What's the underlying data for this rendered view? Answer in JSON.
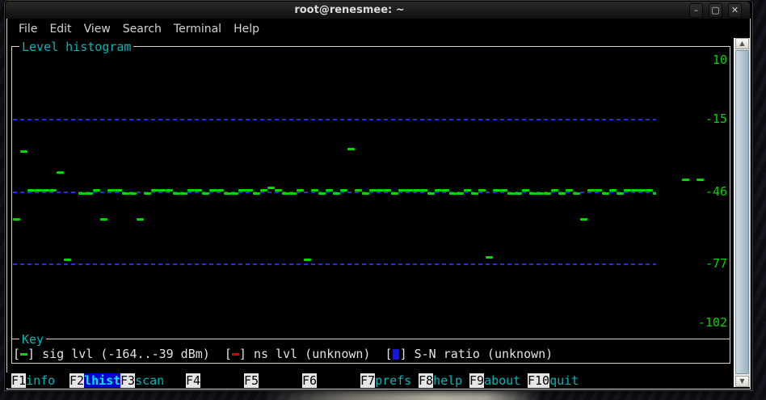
{
  "window": {
    "title": "root@renesmee: ~",
    "controls": [
      {
        "name": "minimize",
        "glyph": "–"
      },
      {
        "name": "maximize",
        "glyph": "▢"
      },
      {
        "name": "close",
        "glyph": "✕"
      }
    ]
  },
  "menu_items": [
    "File",
    "Edit",
    "View",
    "Search",
    "Terminal",
    "Help"
  ],
  "histogram_panel": {
    "title": "Level histogram"
  },
  "key_panel": {
    "title": "Key",
    "entries": [
      {
        "symbol": "dash",
        "symbol_color": "#00d800",
        "label": "sig lvl (-164..-39 dBm)"
      },
      {
        "symbol": "dash",
        "symbol_color": "#d40000",
        "label": "ns lvl (unknown)"
      },
      {
        "symbol": "block",
        "symbol_color": "#1616d6",
        "label": "S-N ratio (unknown)"
      }
    ]
  },
  "fkeys": [
    {
      "key": "F1",
      "label": "info",
      "active": false
    },
    {
      "key": "F2",
      "label": "lhist",
      "active": true
    },
    {
      "key": "F3",
      "label": "scan",
      "active": false
    },
    {
      "key": "F4",
      "label": "",
      "active": false
    },
    {
      "key": "F5",
      "label": "",
      "active": false
    },
    {
      "key": "F6",
      "label": "",
      "active": false
    },
    {
      "key": "F7",
      "label": "prefs",
      "active": false
    },
    {
      "key": "F8",
      "label": "help",
      "active": false
    },
    {
      "key": "F9",
      "label": "about",
      "active": false
    },
    {
      "key": "F10",
      "label": "quit",
      "active": false
    }
  ],
  "chart_data": {
    "type": "line",
    "title": "Level histogram",
    "ylabel": "",
    "ylim": [
      -102,
      10
    ],
    "yticks": [
      10,
      -15,
      -46,
      -77,
      -102
    ],
    "dashed_gridlines_at": [
      -15,
      -46,
      -77
    ],
    "legend_position": "bottom",
    "series": [
      {
        "name": "sig lvl (dBm)",
        "color": "#00d900",
        "samples_dbm": [
          -58,
          -29,
          -45.5,
          -45.5,
          -45.5,
          -45.5,
          -38,
          -75,
          null,
          -46.8,
          -46.8,
          -45.5,
          -58,
          -45.5,
          -45.5,
          -46.8,
          -46.8,
          -58,
          -46.8,
          -45.5,
          -45.5,
          -45.5,
          -46.8,
          -46.8,
          -45.5,
          -45.5,
          -46.8,
          -45.5,
          -45.5,
          -46.8,
          -46.8,
          -45.5,
          -45.5,
          -46.8,
          -45.5,
          -44.5,
          -45.5,
          -46.8,
          -46.8,
          -45.5,
          -75,
          -45.5,
          -46.8,
          -45.5,
          -46.8,
          -45.5,
          -28,
          -45.5,
          -46.8,
          -45.5,
          -45.5,
          -45.5,
          -46.8,
          -45.5,
          -45.5,
          -45.5,
          -45.5,
          -46.8,
          -45.5,
          -45.5,
          -46.8,
          -46.8,
          -45.5,
          -46.8,
          -45.5,
          -74,
          -45.5,
          -45.5,
          -46.8,
          -46.8,
          -45.5,
          -46.8,
          -46.8,
          -46.8,
          -45.5,
          -46.8,
          -45.5,
          -46.8,
          -58,
          -45.5,
          -45.5,
          -46.8,
          -45.5,
          -46.8,
          -45.5,
          -45.5,
          -45.5,
          -45.5,
          -46.8,
          -45.5,
          -46.8,
          -45.5,
          -41,
          null,
          -41
        ]
      },
      {
        "name": "ns lvl",
        "values": "unknown"
      },
      {
        "name": "S-N ratio",
        "values": "unknown"
      }
    ]
  },
  "colors": {
    "signal_green": "#00d900",
    "grid_blue": "#2b2be0",
    "panel_border": "#d9d2c2",
    "title_cyan": "#00b7b7",
    "active_fkey_bg": "#0000cc",
    "legend_red": "#d40000"
  }
}
